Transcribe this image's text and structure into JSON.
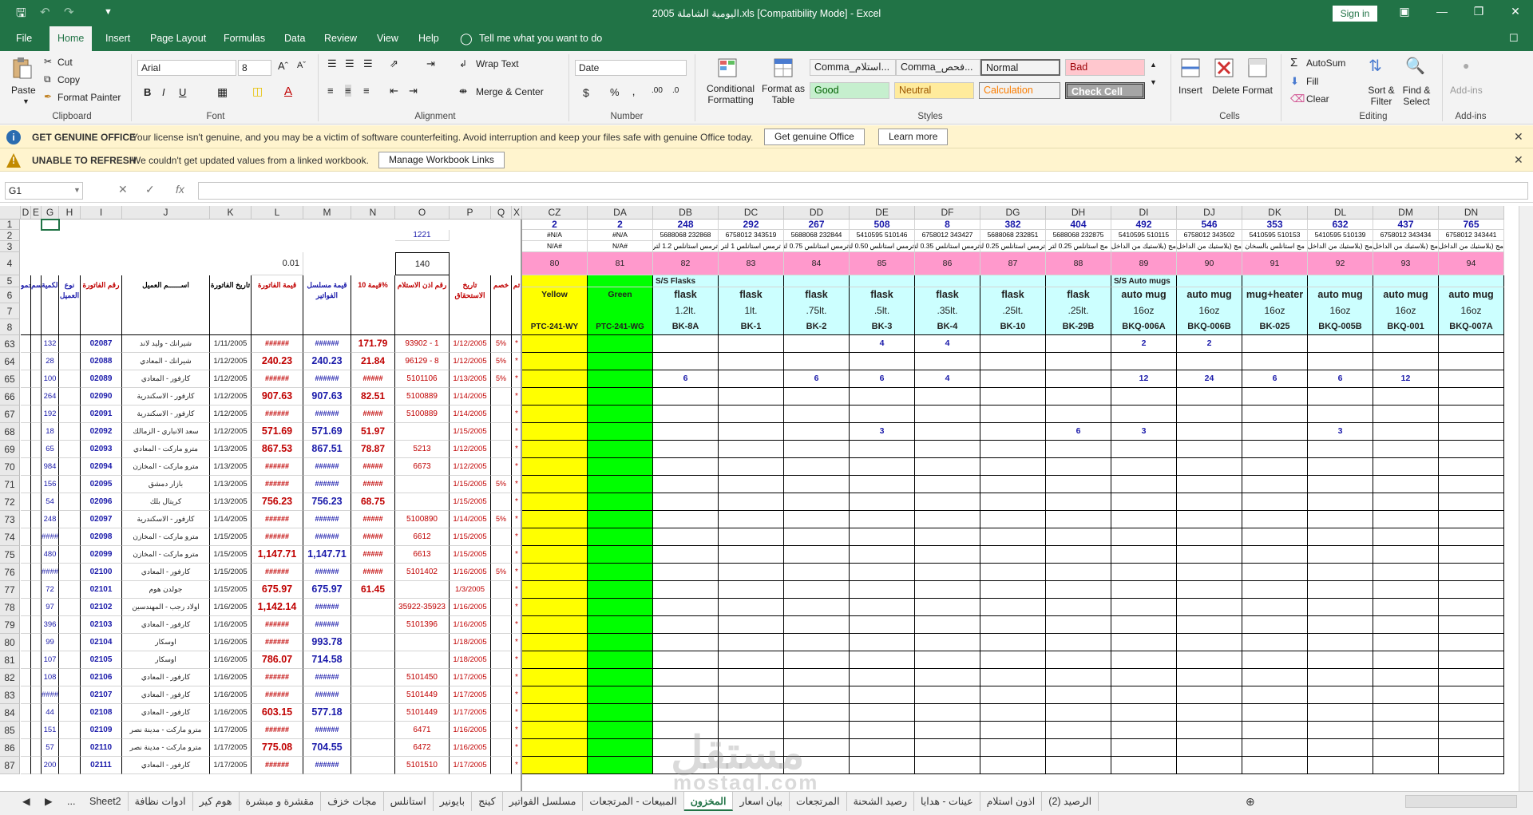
{
  "window": {
    "title": "اليومية الشاملة 2005.xls  [Compatibility Mode]  -  Excel",
    "sign_in": "Sign in"
  },
  "ribbon_tabs": [
    "File",
    "Home",
    "Insert",
    "Page Layout",
    "Formulas",
    "Data",
    "Review",
    "View",
    "Help"
  ],
  "tell_me": "Tell me what you want to do",
  "clipboard": {
    "paste": "Paste",
    "cut": "Cut",
    "copy": "Copy",
    "format_painter": "Format Painter",
    "label": "Clipboard"
  },
  "font": {
    "name": "Arial",
    "size": "8",
    "label": "Font"
  },
  "alignment": {
    "wrap": "Wrap Text",
    "merge": "Merge & Center",
    "label": "Alignment"
  },
  "number": {
    "format": "Date",
    "label": "Number"
  },
  "styles": {
    "conditional": "Conditional Formatting",
    "format_table": "Format as Table",
    "label": "Styles",
    "cells": [
      {
        "text": "Comma_استلام...",
        "bg": "#ffffff",
        "fg": "#222222"
      },
      {
        "text": "Comma_فحص...",
        "bg": "#ffffff",
        "fg": "#222222"
      },
      {
        "text": "Normal",
        "bg": "#ffffff",
        "fg": "#222222"
      },
      {
        "text": "Bad",
        "bg": "#ffc7ce",
        "fg": "#9c0006"
      },
      {
        "text": "Good",
        "bg": "#c6efce",
        "fg": "#006100"
      },
      {
        "text": "Neutral",
        "bg": "#ffeb9c",
        "fg": "#9c5700"
      },
      {
        "text": "Calculation",
        "bg": "#f2f2f2",
        "fg": "#fa7d00"
      },
      {
        "text": "Check Cell",
        "bg": "#a5a5a5",
        "fg": "#ffffff"
      }
    ]
  },
  "cells_group": {
    "insert": "Insert",
    "delete": "Delete",
    "format": "Format",
    "label": "Cells"
  },
  "editing": {
    "autosum": "AutoSum",
    "fill": "Fill",
    "clear": "Clear",
    "sort": "Sort & Filter",
    "find": "Find & Select",
    "label": "Editing"
  },
  "addins": {
    "btn": "Add-ins",
    "label": "Add-ins"
  },
  "messages": {
    "genuine_head": "GET GENUINE OFFICE",
    "genuine_text": "Your license isn't genuine, and you may be a victim of software counterfeiting. Avoid interruption and keep your files safe with genuine Office today.",
    "genuine_btn": "Get genuine Office",
    "learn_btn": "Learn more",
    "refresh_head": "UNABLE TO REFRESH",
    "refresh_text": "We couldn't get updated values from a linked workbook.",
    "refresh_btn": "Manage Workbook Links"
  },
  "formula_bar": {
    "name_box": "G1",
    "fx": "fx"
  },
  "columns_left": [
    "D",
    "E",
    "G",
    "H",
    "I",
    "J",
    "K",
    "L",
    "M",
    "N",
    "O",
    "P",
    "Q",
    "X"
  ],
  "columns_right": [
    "CZ",
    "DA",
    "DB",
    "DC",
    "DD",
    "DE",
    "DF",
    "DG",
    "DH",
    "DI",
    "DJ",
    "DK",
    "DL",
    "DM",
    "DN"
  ],
  "row_numbers": [
    "1",
    "2",
    "3",
    "4",
    "5",
    "6",
    "7",
    "8",
    "63",
    "64",
    "65",
    "66",
    "67",
    "68",
    "69",
    "70",
    "71",
    "72",
    "73",
    "74",
    "75",
    "76",
    "77",
    "78",
    "79",
    "80",
    "81",
    "82",
    "83",
    "84",
    "85",
    "86",
    "87"
  ],
  "top_left": {
    "o2": "1221",
    "l4": "0.01",
    "o4": "140"
  },
  "header_left": {
    "d": "حمو",
    "e": "حسم",
    "g": "الكمية",
    "h": "نوع العميل",
    "i": "رقم الفاتورة",
    "j": "اســــــم العميل",
    "k": "تاريخ الفاتورة",
    "l": "قيمة الفاتورة",
    "m": "قيمة مسلسل الفواتير",
    "n": "قيمة 10%",
    "o": "رقم اذن الاستلام",
    "p": "تاريخ الاستحقاق",
    "q": "خصم",
    "x": "تم"
  },
  "right_header": {
    "row1": [
      "2",
      "2",
      "248",
      "292",
      "267",
      "508",
      "8",
      "382",
      "404",
      "492",
      "546",
      "353",
      "632",
      "437",
      "765"
    ],
    "row2": [
      "#N/A",
      "#N/A",
      "5688068 232868",
      "6758012 343519",
      "5688068 232844",
      "5410595 510146",
      "6758012 343427",
      "5688068 232851",
      "5688068 232875",
      "5410595 510115",
      "6758012 343502",
      "5410595 510153",
      "5410595 510139",
      "6758012 343434",
      "6758012 343441"
    ],
    "row3": [
      "#N/A",
      "#N/A",
      "ترمس استانلس 1.2 لتر",
      "ترمس استانلس 1 لتر",
      "ترمس استانلس 0.75 لتر",
      "ترمس استانلس 0.50 لتر",
      "ترمس استانلس 0.35 لتر",
      "ترمس استانلس 0.25 لتر",
      "مج استانلس 0.25 لتر",
      "مج (بلاستيك من الداخل)",
      "مج (بلاستيك من الداخل)",
      "مج استانلس بالسخان",
      "مج (بلاستيك من الداخل)",
      "مج (بلاستيك من الداخل)",
      "مج (بلاستيك من الداخل)"
    ],
    "row4": [
      "80",
      "81",
      "82",
      "83",
      "84",
      "85",
      "86",
      "87",
      "88",
      "89",
      "90",
      "91",
      "92",
      "93",
      "94"
    ],
    "group_flasks": "S/S Flasks",
    "group_mugs": "S/S Auto mugs",
    "row6": [
      "Yellow",
      "Green",
      "flask",
      "flask",
      "flask",
      "flask",
      "flask",
      "flask",
      "flask",
      "auto mug",
      "auto mug",
      "mug+heater",
      "auto mug",
      "auto mug",
      "auto mug"
    ],
    "row7": [
      "",
      "",
      "1.2lt.",
      "1lt.",
      ".75lt.",
      ".5lt.",
      ".35lt.",
      ".25lt.",
      ".25lt.",
      "16oz",
      "16oz",
      "16oz",
      "16oz",
      "16oz",
      "16oz"
    ],
    "row8": [
      "PTC-241-WY",
      "PTC-241-WG",
      "BK-8A",
      "BK-1",
      "BK-2",
      "BK-3",
      "BK-4",
      "BK-10",
      "BK-29B",
      "BKQ-006A",
      "BKQ-006B",
      "BK-025",
      "BKQ-005B",
      "BKQ-001",
      "BKQ-007A"
    ]
  },
  "data_rows": [
    {
      "g": "132",
      "i": "02087",
      "j": "شيرانك - وليد لاند",
      "k": "1/11/2005",
      "l": "######",
      "m": "######",
      "n": "171.79",
      "o": "93902 - 1",
      "p": "1/12/2005",
      "q": "5%",
      "x": "*",
      "r": [
        "",
        "",
        "",
        "",
        "",
        "4",
        "4",
        "",
        "",
        "2",
        "2",
        "",
        "",
        "",
        ""
      ]
    },
    {
      "g": "28",
      "i": "02088",
      "j": "شيرانك - المعادي",
      "k": "1/12/2005",
      "l": "240.23",
      "m": "240.23",
      "n": "21.84",
      "o": "96129 - 8",
      "p": "1/12/2005",
      "q": "5%",
      "x": "*",
      "r": [
        "",
        "",
        "",
        "",
        "",
        "",
        "",
        "",
        "",
        "",
        "",
        "",
        "",
        "",
        ""
      ]
    },
    {
      "g": "100",
      "i": "02089",
      "j": "كارفور - المعادي",
      "k": "1/12/2005",
      "l": "######",
      "m": "######",
      "n": "#####",
      "o": "5101106",
      "p": "1/13/2005",
      "q": "5%",
      "x": "*",
      "r": [
        "",
        "",
        "6",
        "",
        "6",
        "6",
        "4",
        "",
        "",
        "12",
        "24",
        "6",
        "6",
        "12",
        ""
      ]
    },
    {
      "g": "264",
      "i": "02090",
      "j": "كارفور - الاسكندرية",
      "k": "1/12/2005",
      "l": "907.63",
      "m": "907.63",
      "n": "82.51",
      "o": "5100889",
      "p": "1/14/2005",
      "q": "",
      "x": "*",
      "r": [
        "",
        "",
        "",
        "",
        "",
        "",
        "",
        "",
        "",
        "",
        "",
        "",
        "",
        "",
        ""
      ]
    },
    {
      "g": "192",
      "i": "02091",
      "j": "كارفور - الاسكندرية",
      "k": "1/12/2005",
      "l": "######",
      "m": "######",
      "n": "#####",
      "o": "5100889",
      "p": "1/14/2005",
      "q": "",
      "x": "*",
      "r": [
        "",
        "",
        "",
        "",
        "",
        "",
        "",
        "",
        "",
        "",
        "",
        "",
        "",
        "",
        ""
      ]
    },
    {
      "g": "18",
      "i": "02092",
      "j": "سعد الانباري - الزمالك",
      "k": "1/12/2005",
      "l": "571.69",
      "m": "571.69",
      "n": "51.97",
      "o": "",
      "p": "1/15/2005",
      "q": "",
      "x": "*",
      "r": [
        "",
        "",
        "",
        "",
        "",
        "3",
        "",
        "",
        "6",
        "3",
        "",
        "",
        "3",
        "",
        ""
      ]
    },
    {
      "g": "65",
      "i": "02093",
      "j": "مترو ماركت - المعادي",
      "k": "1/13/2005",
      "l": "867.53",
      "m": "867.51",
      "n": "78.87",
      "o": "5213",
      "p": "1/12/2005",
      "q": "",
      "x": "*",
      "r": [
        "",
        "",
        "",
        "",
        "",
        "",
        "",
        "",
        "",
        "",
        "",
        "",
        "",
        "",
        ""
      ]
    },
    {
      "g": "984",
      "i": "02094",
      "j": "مترو ماركت - المخازن",
      "k": "1/13/2005",
      "l": "######",
      "m": "######",
      "n": "#####",
      "o": "6673",
      "p": "1/12/2005",
      "q": "",
      "x": "*",
      "r": [
        "",
        "",
        "",
        "",
        "",
        "",
        "",
        "",
        "",
        "",
        "",
        "",
        "",
        "",
        ""
      ]
    },
    {
      "g": "156",
      "i": "02095",
      "j": "بازار دمشق",
      "k": "1/13/2005",
      "l": "######",
      "m": "######",
      "n": "#####",
      "o": "",
      "p": "1/15/2005",
      "q": "5%",
      "x": "*",
      "r": [
        "",
        "",
        "",
        "",
        "",
        "",
        "",
        "",
        "",
        "",
        "",
        "",
        "",
        "",
        ""
      ]
    },
    {
      "g": "54",
      "i": "02096",
      "j": "كريتال بلك",
      "k": "1/13/2005",
      "l": "756.23",
      "m": "756.23",
      "n": "68.75",
      "o": "",
      "p": "1/15/2005",
      "q": "",
      "x": "*",
      "r": [
        "",
        "",
        "",
        "",
        "",
        "",
        "",
        "",
        "",
        "",
        "",
        "",
        "",
        "",
        ""
      ]
    },
    {
      "g": "248",
      "i": "02097",
      "j": "كارفور - الاسكندرية",
      "k": "1/14/2005",
      "l": "######",
      "m": "######",
      "n": "#####",
      "o": "5100890",
      "p": "1/14/2005",
      "q": "5%",
      "x": "*",
      "r": [
        "",
        "",
        "",
        "",
        "",
        "",
        "",
        "",
        "",
        "",
        "",
        "",
        "",
        "",
        ""
      ]
    },
    {
      "g": "####",
      "i": "02098",
      "j": "مترو ماركت - المخازن",
      "k": "1/15/2005",
      "l": "######",
      "m": "######",
      "n": "#####",
      "o": "6612",
      "p": "1/15/2005",
      "q": "",
      "x": "*",
      "r": [
        "",
        "",
        "",
        "",
        "",
        "",
        "",
        "",
        "",
        "",
        "",
        "",
        "",
        "",
        ""
      ]
    },
    {
      "g": "480",
      "i": "02099",
      "j": "مترو ماركت - المخازن",
      "k": "1/15/2005",
      "l": "1,147.71",
      "m": "1,147.71",
      "n": "#####",
      "o": "6613",
      "p": "1/15/2005",
      "q": "",
      "x": "*",
      "r": [
        "",
        "",
        "",
        "",
        "",
        "",
        "",
        "",
        "",
        "",
        "",
        "",
        "",
        "",
        ""
      ]
    },
    {
      "g": "####",
      "i": "02100",
      "j": "كارفور - المعادي",
      "k": "1/15/2005",
      "l": "######",
      "m": "######",
      "n": "#####",
      "o": "5101402",
      "p": "1/16/2005",
      "q": "5%",
      "x": "*",
      "r": [
        "",
        "",
        "",
        "",
        "",
        "",
        "",
        "",
        "",
        "",
        "",
        "",
        "",
        "",
        ""
      ]
    },
    {
      "g": "72",
      "i": "02101",
      "j": "جولدن هوم",
      "k": "1/15/2005",
      "l": "675.97",
      "m": "675.97",
      "n": "61.45",
      "o": "",
      "p": "1/3/2005",
      "q": "",
      "x": "*",
      "r": [
        "",
        "",
        "",
        "",
        "",
        "",
        "",
        "",
        "",
        "",
        "",
        "",
        "",
        "",
        ""
      ]
    },
    {
      "g": "97",
      "i": "02102",
      "j": "اولاد رجب - المهندسين",
      "k": "1/16/2005",
      "l": "1,142.14",
      "m": "######",
      "n": "",
      "o": "35922-35923",
      "p": "1/16/2005",
      "q": "",
      "x": "*",
      "r": [
        "",
        "",
        "",
        "",
        "",
        "",
        "",
        "",
        "",
        "",
        "",
        "",
        "",
        "",
        ""
      ]
    },
    {
      "g": "396",
      "i": "02103",
      "j": "كارفور - المعادي",
      "k": "1/16/2005",
      "l": "######",
      "m": "######",
      "n": "",
      "o": "5101396",
      "p": "1/16/2005",
      "q": "",
      "x": "*",
      "r": [
        "",
        "",
        "",
        "",
        "",
        "",
        "",
        "",
        "",
        "",
        "",
        "",
        "",
        "",
        ""
      ]
    },
    {
      "g": "99",
      "i": "02104",
      "j": "اوسكار",
      "k": "1/16/2005",
      "l": "######",
      "m": "993.78",
      "n": "",
      "o": "",
      "p": "1/18/2005",
      "q": "",
      "x": "*",
      "r": [
        "",
        "",
        "",
        "",
        "",
        "",
        "",
        "",
        "",
        "",
        "",
        "",
        "",
        "",
        ""
      ]
    },
    {
      "g": "107",
      "i": "02105",
      "j": "اوسكار",
      "k": "1/16/2005",
      "l": "786.07",
      "m": "714.58",
      "n": "",
      "o": "",
      "p": "1/18/2005",
      "q": "",
      "x": "*",
      "r": [
        "",
        "",
        "",
        "",
        "",
        "",
        "",
        "",
        "",
        "",
        "",
        "",
        "",
        "",
        ""
      ]
    },
    {
      "g": "108",
      "i": "02106",
      "j": "كارفور - المعادي",
      "k": "1/16/2005",
      "l": "######",
      "m": "######",
      "n": "",
      "o": "5101450",
      "p": "1/17/2005",
      "q": "",
      "x": "*",
      "r": [
        "",
        "",
        "",
        "",
        "",
        "",
        "",
        "",
        "",
        "",
        "",
        "",
        "",
        "",
        ""
      ]
    },
    {
      "g": "####",
      "i": "02107",
      "j": "كارفور - المعادي",
      "k": "1/16/2005",
      "l": "######",
      "m": "######",
      "n": "",
      "o": "5101449",
      "p": "1/17/2005",
      "q": "",
      "x": "*",
      "r": [
        "",
        "",
        "",
        "",
        "",
        "",
        "",
        "",
        "",
        "",
        "",
        "",
        "",
        "",
        ""
      ]
    },
    {
      "g": "44",
      "i": "02108",
      "j": "كارفور - المعادي",
      "k": "1/16/2005",
      "l": "603.15",
      "m": "577.18",
      "n": "",
      "o": "5101449",
      "p": "1/17/2005",
      "q": "",
      "x": "*",
      "r": [
        "",
        "",
        "",
        "",
        "",
        "",
        "",
        "",
        "",
        "",
        "",
        "",
        "",
        "",
        ""
      ]
    },
    {
      "g": "151",
      "i": "02109",
      "j": "مترو ماركت - مدينة نصر",
      "k": "1/17/2005",
      "l": "######",
      "m": "######",
      "n": "",
      "o": "6471",
      "p": "1/16/2005",
      "q": "",
      "x": "*",
      "r": [
        "",
        "",
        "",
        "",
        "",
        "",
        "",
        "",
        "",
        "",
        "",
        "",
        "",
        "",
        ""
      ]
    },
    {
      "g": "57",
      "i": "02110",
      "j": "مترو ماركت - مدينة نصر",
      "k": "1/17/2005",
      "l": "775.08",
      "m": "704.55",
      "n": "",
      "o": "6472",
      "p": "1/16/2005",
      "q": "",
      "x": "*",
      "r": [
        "",
        "",
        "",
        "",
        "",
        "",
        "",
        "",
        "",
        "",
        "",
        "",
        "",
        "",
        ""
      ]
    },
    {
      "g": "200",
      "i": "02111",
      "j": "كارفور - المعادي",
      "k": "1/17/2005",
      "l": "######",
      "m": "######",
      "n": "",
      "o": "5101510",
      "p": "1/17/2005",
      "q": "",
      "x": "*",
      "r": [
        "",
        "",
        "",
        "",
        "",
        "",
        "",
        "",
        "",
        "",
        "",
        "",
        "",
        "",
        ""
      ]
    }
  ],
  "sheet_tabs": [
    "Sheet2",
    "ادوات نظافة",
    "هوم كير",
    "مقشرة و مبشرة",
    "مجات خزف",
    "استانلس",
    "بايونير",
    "كينج",
    "مسلسل الفواتير",
    "المبيعات - المرتجعات",
    "المخزون",
    "بيان اسعار",
    "المرتجعات",
    "رصيد الشحنة",
    "عينات - هدايا",
    "اذون استلام",
    "الرصيد (2)"
  ],
  "active_sheet": "المخزون",
  "watermark": {
    "arabic": "مستقل",
    "latin": "mostaql.com"
  }
}
